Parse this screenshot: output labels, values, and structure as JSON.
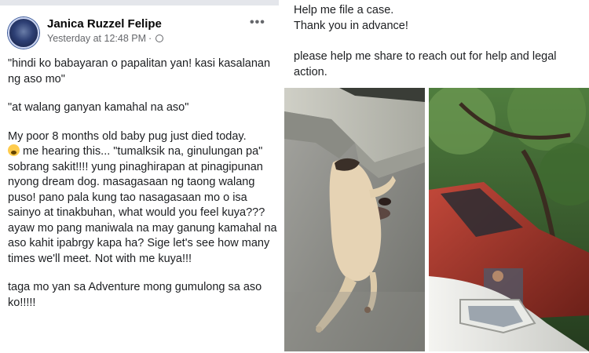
{
  "post": {
    "author": "Janica Ruzzel Felipe",
    "timestamp": "Yesterday at 12:48 PM",
    "separator": "·",
    "audience_icon": "globe-icon",
    "more_label": "•••",
    "paragraphs": {
      "p1": "\"hindi ko babayaran o papalitan yan! kasi kasalanan ng aso mo\"",
      "p2": "\"at walang ganyan kamahal na aso\"",
      "p3_start": "My poor 8 months old baby pug just died today.",
      "p3_emoji": "crying-face-emoji",
      "p3_end": " me hearing this... \"tumalksik na, ginulungan pa\" sobrang sakit!!!! yung pinaghirapan at pinagipunan nyong dream dog. masagasaan ng taong walang puso! pano pala kung tao nasagasaan mo o isa sainyo at tinakbuhan, what would you feel kuya??? ayaw mo pang maniwala na may ganung kamahal na aso kahit ipabrgy kapa ha? Sige let's see how many times we'll meet. Not with me kuya!!!",
      "p4": "taga mo yan sa Adventure mong gumulong sa aso ko!!!!!"
    },
    "continued": {
      "line1": "Help me file a case.",
      "line2": "Thank you in advance!",
      "line3": "please help me share to reach out for help and legal action."
    }
  },
  "photos": {
    "photo1": "dog-on-road-photo",
    "photo2": "car-side-mirror-photo"
  },
  "colors": {
    "text": "#1c1e21",
    "secondary": "#65676b",
    "divider": "#e4e6eb"
  }
}
